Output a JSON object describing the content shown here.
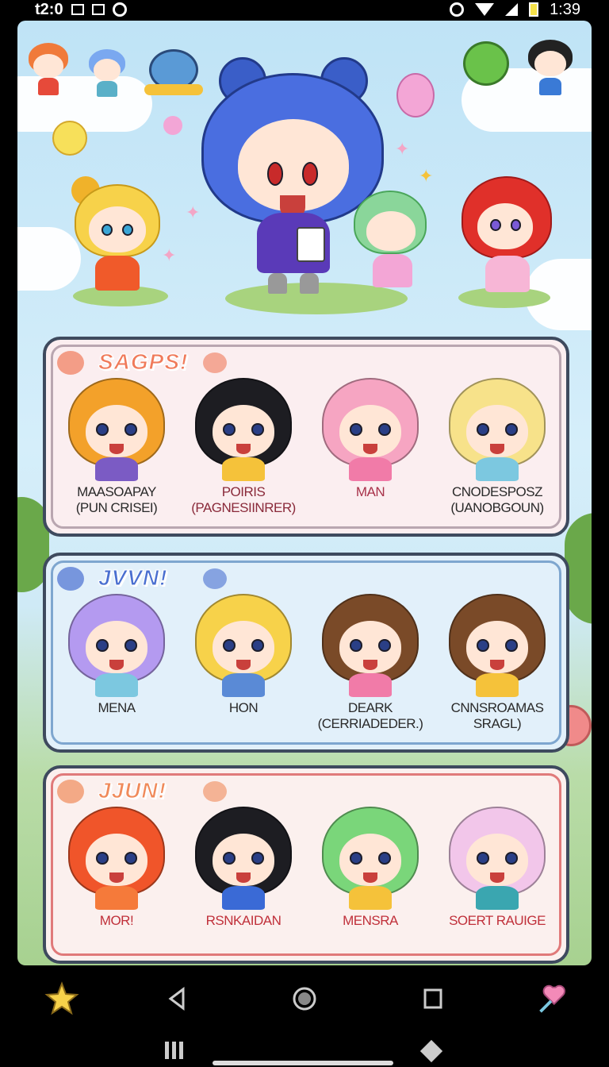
{
  "status_bar": {
    "time_left": "t2:0",
    "time_right": "1:39",
    "icons_left": [
      "phone-icon",
      "screen-icon",
      "ring-icon"
    ],
    "icons_right": [
      "alarm-icon",
      "wifi-icon",
      "signal-icon",
      "battery-icon"
    ],
    "battery_color": "#f5e14a"
  },
  "panels": [
    {
      "title": "SAGPS!",
      "title_color": "#f07a5a",
      "bg": "#fbeef0",
      "border": "#b9a6b0",
      "members": [
        {
          "line1": "MAASOAPAY",
          "line2": "(PUN CRISEI)",
          "color": "#2a2a2a",
          "hair": "#f3a12a",
          "outfit": "#7b5bc4"
        },
        {
          "line1": "POIRIS",
          "line2": "(PAGNESIINRER)",
          "color": "#8a2a3a",
          "hair": "#1d1d22",
          "outfit": "#f5c23a"
        },
        {
          "line1": "MAN",
          "line2": "",
          "color": "#a8324a",
          "hair": "#f6a5c2",
          "outfit": "#f17ba8"
        },
        {
          "line1": "CNODESPOSZ",
          "line2": "(UANOBGOUN)",
          "color": "#2a2a2a",
          "hair": "#f7e28a",
          "outfit": "#7cc8e0"
        }
      ]
    },
    {
      "title": "JVVN!",
      "title_color": "#4a6fd0",
      "bg": "#e2f0fa",
      "border": "#7ea6cf",
      "members": [
        {
          "line1": "MENA",
          "line2": "",
          "color": "#2a2a2a",
          "hair": "#b49af0",
          "outfit": "#7cc8e0"
        },
        {
          "line1": "HON",
          "line2": "",
          "color": "#2a2a2a",
          "hair": "#f7d24a",
          "outfit": "#5a8ad6"
        },
        {
          "line1": "DEARK",
          "line2": "(CERRIADEDER.)",
          "color": "#2a2a2a",
          "hair": "#7a4a28",
          "outfit": "#f17ba8"
        },
        {
          "line1": "CNNSROAMAS",
          "line2": "SRAGL)",
          "color": "#2a2a2a",
          "hair": "#7a4a28",
          "outfit": "#f5c23a"
        }
      ]
    },
    {
      "title": "JJUN!",
      "title_color": "#f08a5a",
      "bg": "#fbf0ee",
      "border": "#e07a7a",
      "members": [
        {
          "line1": "MOR!",
          "line2": "",
          "color": "#c0303a",
          "hair": "#f0552a",
          "outfit": "#f57a3a"
        },
        {
          "line1": "RSNKAIDAN",
          "line2": "",
          "color": "#c0303a",
          "hair": "#1d1d22",
          "outfit": "#3a6ad6"
        },
        {
          "line1": "MENSRA",
          "line2": "",
          "color": "#c0303a",
          "hair": "#7ad67a",
          "outfit": "#f5c23a"
        },
        {
          "line1": "SOERT RAUIGE",
          "line2": "",
          "color": "#c0303a",
          "hair": "#f2c6ea",
          "outfit": "#3aa6b0"
        }
      ]
    }
  ],
  "nav": {
    "left": "star-icon",
    "back": "back-icon",
    "home": "home-icon",
    "recents": "recents-icon",
    "right": "heart-wand-icon"
  },
  "colors": {
    "sky_top": "#bfe3f6",
    "panel_outline": "#3e4a5e",
    "grass": "#a8d37e"
  }
}
